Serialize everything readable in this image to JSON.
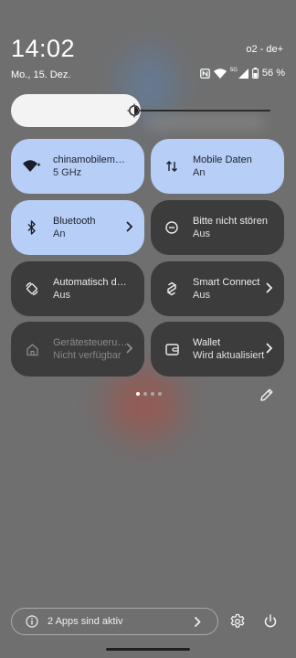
{
  "status": {
    "time": "14:02",
    "date": "Mo., 15. Dez.",
    "carrier": "o2 - de+",
    "network_type": "5G",
    "battery": "56 %",
    "icons": [
      "nfc-icon",
      "wifi-icon",
      "signal-icon",
      "battery-icon"
    ]
  },
  "brightness": {
    "level": 0.5,
    "icon": "brightness-icon"
  },
  "tiles": [
    {
      "title": "chinamobilemag.de",
      "subtitle": "5 GHz",
      "state": "on",
      "icon": "wifi-icon"
    },
    {
      "title": "Mobile Daten",
      "subtitle": "An",
      "state": "on",
      "icon": "mobile-data-icon"
    },
    {
      "title": "Bluetooth",
      "subtitle": "An",
      "state": "on",
      "icon": "bluetooth-icon",
      "chevron": true
    },
    {
      "title": "Bitte nicht stören",
      "subtitle": "Aus",
      "state": "off",
      "icon": "do-not-disturb-icon"
    },
    {
      "title": "Automatisch drehen",
      "subtitle": "Aus",
      "state": "off",
      "icon": "auto-rotate-icon"
    },
    {
      "title": "Smart Connect",
      "subtitle": "Aus",
      "state": "off",
      "icon": "smart-connect-icon",
      "chevron": true
    },
    {
      "title": "Gerätesteuerung",
      "subtitle": "Nicht verfügbar",
      "state": "disabled",
      "icon": "home-icon",
      "chevron": true
    },
    {
      "title": "Wallet",
      "subtitle": "Wird aktualisiert",
      "state": "off",
      "icon": "wallet-icon",
      "chevron": true
    }
  ],
  "pager": {
    "pages": 4,
    "current": 1
  },
  "footer": {
    "active_apps_label": "2 Apps sind aktiv",
    "icons": [
      "info-icon",
      "chevron-right-icon",
      "settings-icon",
      "power-icon"
    ]
  },
  "colors": {
    "tile_on": "#b7cef7",
    "tile_off": "#3c3c3c",
    "background": "#6f6f6f"
  }
}
